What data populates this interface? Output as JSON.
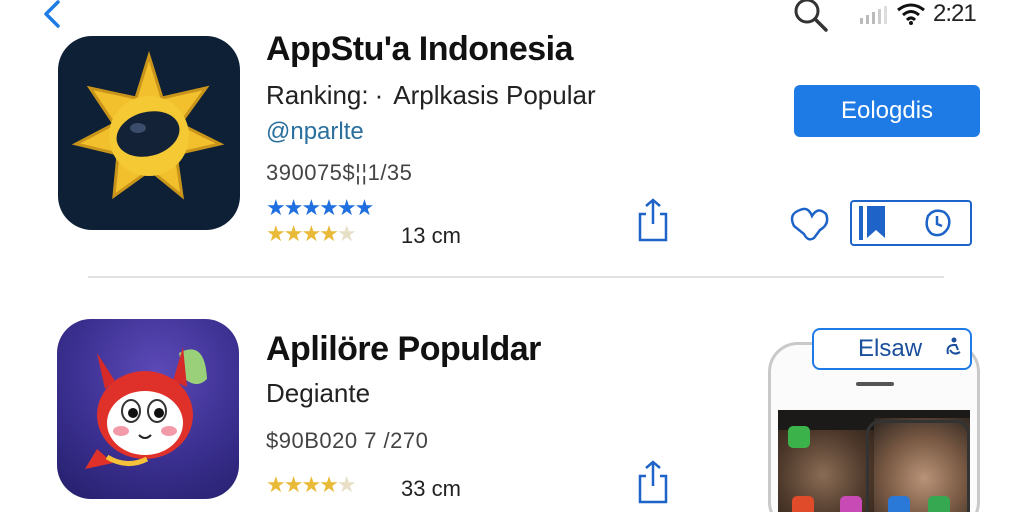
{
  "status_bar": {
    "time": "2:21"
  },
  "apps": [
    {
      "title": "AppStu'a Indonesia",
      "subtitle_label": "Ranking:",
      "subtitle_sep": "·",
      "subtitle_value": "Arplkasis Popular",
      "developer": "@nparlte",
      "price": "390075$¦¦1/35",
      "rating_stars": 4,
      "size": "13 cm",
      "button_label": "Eologdis"
    },
    {
      "title": "Aplilöre Populdar",
      "subtitle": "Degiante",
      "price": "$90B020 7 /270",
      "rating_stars": 4,
      "size": "33 cm",
      "button_label": "Elsaw"
    }
  ],
  "colors": {
    "accent": "#1e7be6",
    "star_gold": "#e9b938",
    "star_blue": "#1f6fe0"
  }
}
